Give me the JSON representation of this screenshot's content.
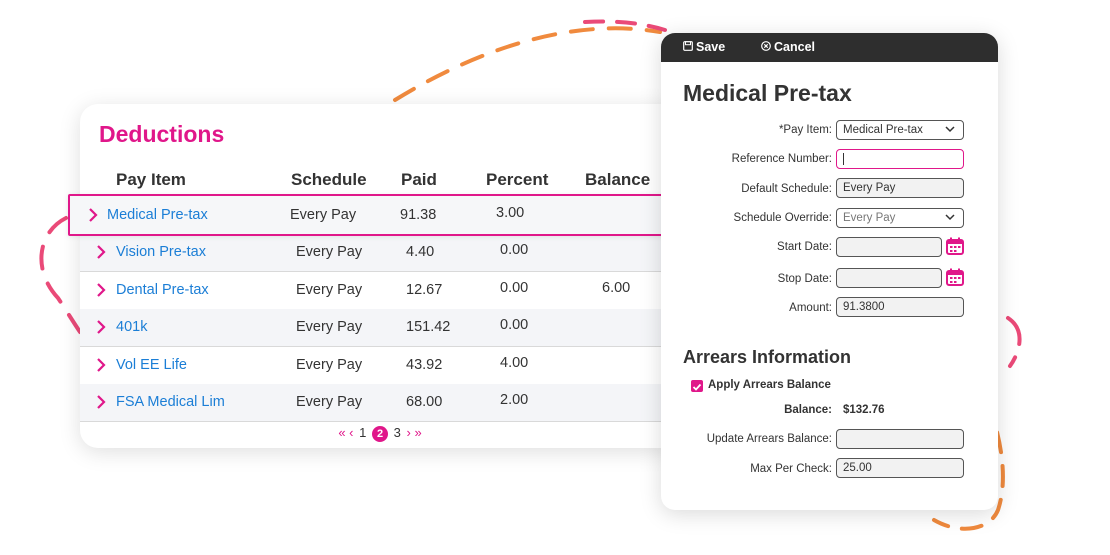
{
  "colors": {
    "accent": "#e0178a",
    "link": "#1b7ed6",
    "dash_orange": "#f08a3e",
    "dash_pink": "#ea4a78"
  },
  "deductions": {
    "title": "Deductions",
    "columns": [
      "Pay Item",
      "Schedule",
      "Paid",
      "Percent",
      "Balance"
    ],
    "selected_row": {
      "name": "Medical Pre-tax",
      "schedule": "Every Pay",
      "paid": "91.38",
      "percent": "3.00",
      "balance": ""
    },
    "rows": [
      {
        "name": "Vision Pre-tax",
        "schedule": "Every Pay",
        "paid": "4.40",
        "percent": "0.00",
        "balance": ""
      },
      {
        "name": "Dental Pre-tax",
        "schedule": "Every Pay",
        "paid": "12.67",
        "percent": "0.00",
        "balance": "6.00"
      },
      {
        "name": "401k",
        "schedule": "Every Pay",
        "paid": "151.42",
        "percent": "0.00",
        "balance": ""
      },
      {
        "name": "Vol EE Life",
        "schedule": "Every Pay",
        "paid": "43.92",
        "percent": "4.00",
        "balance": ""
      },
      {
        "name": "FSA Medical Lim",
        "schedule": "Every Pay",
        "paid": "68.00",
        "percent": "2.00",
        "balance": ""
      }
    ],
    "pagination": {
      "first": "«",
      "prev": "‹",
      "pages": [
        "1",
        "2",
        "3"
      ],
      "current": "2",
      "next": "›",
      "last": "»"
    }
  },
  "editor": {
    "save_label": "Save",
    "cancel_label": "Cancel",
    "title": "Medical Pre-tax",
    "pay_item": {
      "label": "*Pay Item:",
      "value": "Medical Pre-tax"
    },
    "reference_number": {
      "label": "Reference Number:",
      "value": ""
    },
    "default_schedule": {
      "label": "Default Schedule:",
      "value": "Every Pay"
    },
    "schedule_override": {
      "label": "Schedule Override:",
      "value": "Every Pay"
    },
    "start_date": {
      "label": "Start Date:",
      "value": ""
    },
    "stop_date": {
      "label": "Stop Date:",
      "value": ""
    },
    "amount": {
      "label": "Amount:",
      "value": "91.3800"
    },
    "arrears_title": "Arrears Information",
    "apply_arrears": {
      "label": "Apply Arrears Balance",
      "checked": true
    },
    "balance": {
      "label": "Balance:",
      "value": "$132.76"
    },
    "update_arrears": {
      "label": "Update Arrears Balance:",
      "value": ""
    },
    "max_per_check": {
      "label": "Max Per Check:",
      "value": "25.00"
    }
  }
}
